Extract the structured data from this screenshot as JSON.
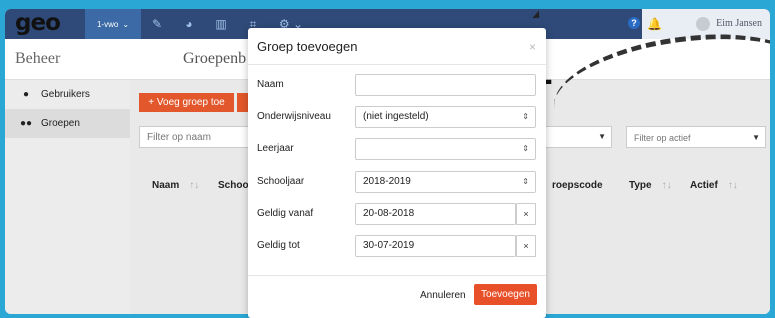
{
  "topbar": {
    "logo": "geo",
    "level": "1-vwo",
    "user_name": "Eim Jansen",
    "help": "?"
  },
  "subheader": {
    "section": "Beheer",
    "page": "Groepenb"
  },
  "sidebar": {
    "items": [
      {
        "label": "Gebruikers",
        "icon": "user-icon"
      },
      {
        "label": "Groepen",
        "icon": "users-icon"
      }
    ]
  },
  "main": {
    "add_button": "Voeg groep toe",
    "filter_name_placeholder": "Filter op naam",
    "filter_active_placeholder": "Filter op actief",
    "columns": [
      "Naam",
      "Schoolj",
      "roepscode",
      "Type",
      "Actief"
    ]
  },
  "modal": {
    "title": "Groep toevoegen",
    "close": "×",
    "fields": [
      {
        "label": "Naam",
        "value": ""
      },
      {
        "label": "Onderwijsniveau",
        "value": "(niet ingesteld)"
      },
      {
        "label": "Leerjaar",
        "value": ""
      },
      {
        "label": "Schooljaar",
        "value": "2018-2019"
      },
      {
        "label": "Geldig vanaf",
        "value": "20-08-2018"
      },
      {
        "label": "Geldig tot",
        "value": "30-07-2019"
      }
    ],
    "cancel": "Annuleren",
    "submit": "Toevoegen"
  },
  "colors": {
    "topbar": "#2f4a78",
    "accent": "#e8502a",
    "frame_bg": "#2aa7d4"
  }
}
